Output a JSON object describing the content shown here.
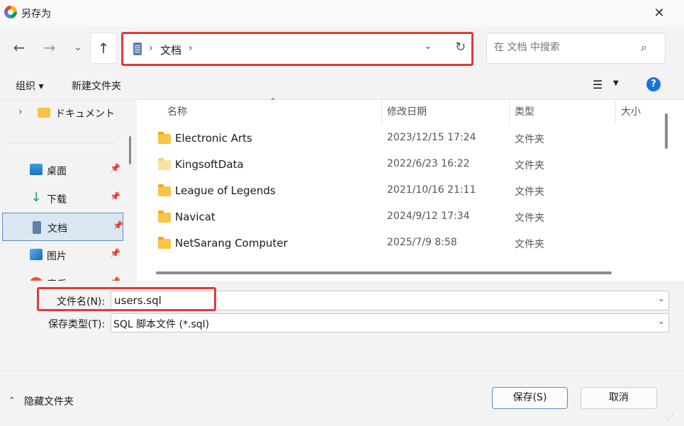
{
  "window": {
    "title": "另存为",
    "close": "✕"
  },
  "nav": {
    "back": "←",
    "forward": "→",
    "recent": "⌄",
    "up": "↑",
    "address": {
      "sep": "›",
      "location": "文档",
      "dropdown": "⌄",
      "refresh": "↻"
    },
    "search": {
      "placeholder": "在 文档 中搜索",
      "icon": "⌕"
    }
  },
  "commandbar": {
    "organize": "组织 ▾",
    "new_folder": "新建文件夹",
    "view": "☰",
    "view_caret": "▼",
    "help": "?"
  },
  "sidebar": {
    "parent": {
      "chevron": "›",
      "label": "ドキュメント"
    },
    "items": [
      {
        "label": "桌面",
        "icon": "desktop-icon"
      },
      {
        "label": "下载",
        "icon": "download-icon"
      },
      {
        "label": "文档",
        "icon": "document-icon",
        "selected": true
      },
      {
        "label": "图片",
        "icon": "pictures-icon"
      },
      {
        "label": "音乐",
        "icon": "music-icon"
      }
    ],
    "pin": "📌"
  },
  "columns": {
    "name": "名称",
    "date": "修改日期",
    "type": "类型",
    "size": "大小",
    "sort_arrow": "⌃"
  },
  "files": [
    {
      "name": "Electronic Arts",
      "date": "2023/12/15 17:24",
      "type": "文件夹"
    },
    {
      "name": "KingsoftData",
      "date": "2022/6/23 16:22",
      "type": "文件夹"
    },
    {
      "name": "League of Legends",
      "date": "2021/10/16 21:11",
      "type": "文件夹"
    },
    {
      "name": "Navicat",
      "date": "2024/9/12 17:34",
      "type": "文件夹"
    },
    {
      "name": "NetSarang Computer",
      "date": "2025/7/9 8:58",
      "type": "文件夹"
    }
  ],
  "form": {
    "filename_label": "文件名(N):",
    "filename_value": "users.sql",
    "filetype_label": "保存类型(T):",
    "filetype_value": "SQL 脚本文件 (*.sql)",
    "caret": "⌄"
  },
  "footer": {
    "hide_caret": "⌃",
    "hide_folders": "隐藏文件夹",
    "save": "保存(S)",
    "cancel": "取消"
  }
}
